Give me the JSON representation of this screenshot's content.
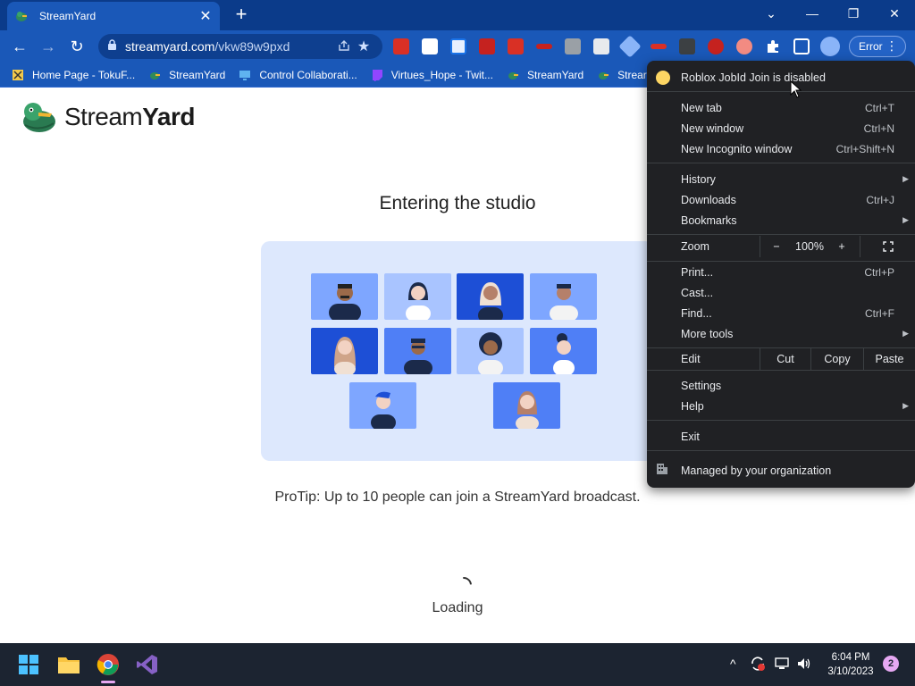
{
  "browser": {
    "tab": {
      "title": "StreamYard",
      "close": "✕"
    },
    "new_tab": "+",
    "window_controls": {
      "tab_search": "⌄",
      "minimize": "—",
      "restore": "❐",
      "close": "✕"
    },
    "nav": {
      "back": "←",
      "forward": "→",
      "reload": "↻"
    },
    "omnibox": {
      "host": "streamyard.com",
      "path": "/vkw89w9pxd"
    },
    "profile_button": "Error",
    "bookmarks": [
      {
        "label": "Home Page - TokuF...",
        "icon": "shield-icon"
      },
      {
        "label": "StreamYard",
        "icon": "duck-icon"
      },
      {
        "label": "Control Collaborati...",
        "icon": "monitor-icon"
      },
      {
        "label": "Virtues_Hope - Twit...",
        "icon": "twitch-icon"
      },
      {
        "label": "StreamYard",
        "icon": "duck-icon"
      },
      {
        "label": "Strear",
        "icon": "duck-icon"
      }
    ]
  },
  "page": {
    "logo": {
      "stream": "Stream",
      "yard": "Yard"
    },
    "heading": "Entering the studio",
    "protip": "ProTip: Up to 10 people can join a StreamYard broadcast.",
    "loading": "Loading"
  },
  "menu": {
    "notice": "Roblox JobId Join is disabled",
    "items_group1": [
      {
        "label": "New tab",
        "shortcut": "Ctrl+T"
      },
      {
        "label": "New window",
        "shortcut": "Ctrl+N"
      },
      {
        "label": "New Incognito window",
        "shortcut": "Ctrl+Shift+N"
      }
    ],
    "items_group2": [
      {
        "label": "History",
        "shortcut": ""
      },
      {
        "label": "Downloads",
        "shortcut": "Ctrl+J"
      },
      {
        "label": "Bookmarks",
        "shortcut": ""
      }
    ],
    "zoom": {
      "label": "Zoom",
      "minus": "−",
      "value": "100%",
      "plus": "+"
    },
    "items_group3": [
      {
        "label": "Print...",
        "shortcut": "Ctrl+P"
      },
      {
        "label": "Cast...",
        "shortcut": ""
      },
      {
        "label": "Find...",
        "shortcut": "Ctrl+F"
      },
      {
        "label": "More tools",
        "shortcut": ""
      }
    ],
    "edit": {
      "label": "Edit",
      "cut": "Cut",
      "copy": "Copy",
      "paste": "Paste"
    },
    "items_group4": [
      {
        "label": "Settings"
      },
      {
        "label": "Help"
      }
    ],
    "exit": "Exit",
    "managed": "Managed by your organization"
  },
  "taskbar": {
    "time": "6:04 PM",
    "date": "3/10/2023",
    "notifications": "2",
    "tray_chevron": "^"
  },
  "colors": {
    "chrome_frame": "#0b3b8a",
    "chrome_toolbar": "#1a58b8",
    "menu_bg": "#202124",
    "illustration_bg": "#dde8fd"
  }
}
